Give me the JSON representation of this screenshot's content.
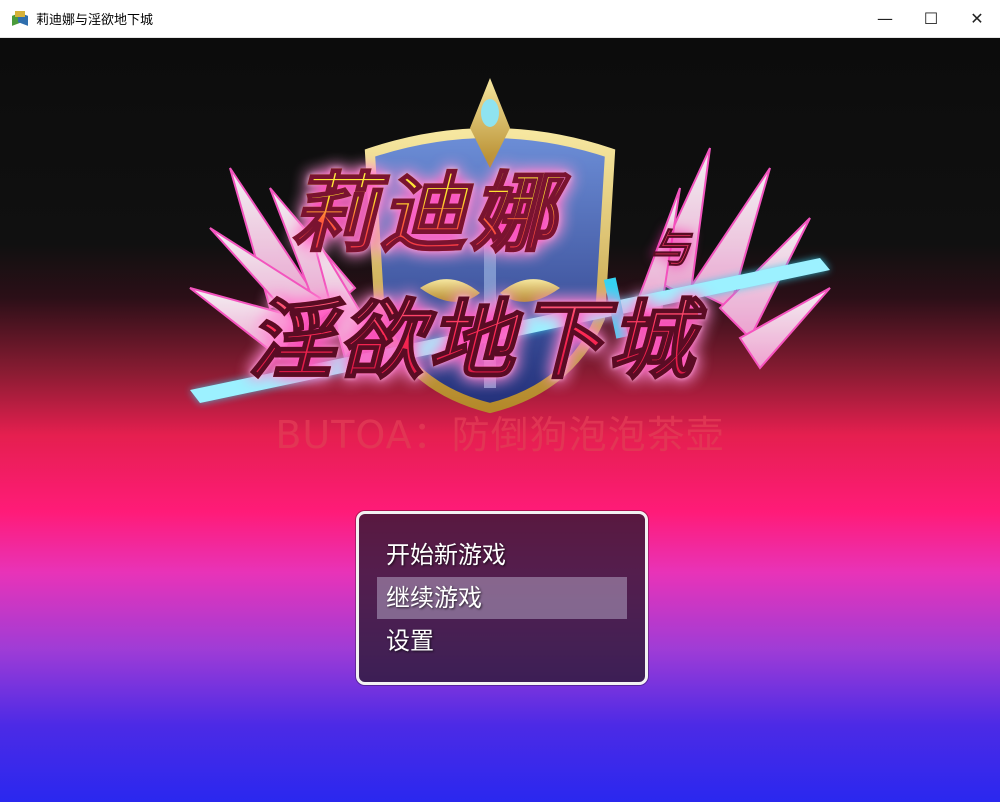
{
  "window": {
    "title": "莉迪娜与淫欲地下城",
    "minimize_glyph": "—",
    "maximize_glyph": "☐",
    "close_glyph": "✕"
  },
  "logo": {
    "line1": "莉迪娜",
    "connector": "与",
    "line2": "淫欲地下城"
  },
  "subtitle": "BUTOA：防倒狗泡泡茶壶",
  "menu": {
    "items": [
      {
        "label": "开始新游戏",
        "selected": false
      },
      {
        "label": "继续游戏",
        "selected": true
      },
      {
        "label": "设置",
        "selected": false
      }
    ]
  },
  "colors": {
    "logo_yellow": "#ffe12a",
    "logo_red": "#e81a4d",
    "subtitle": "#e23a55",
    "menu_border": "#f2f2f2",
    "sword_blue": "#34d3f2",
    "shield_blue": "#3b63b8"
  }
}
